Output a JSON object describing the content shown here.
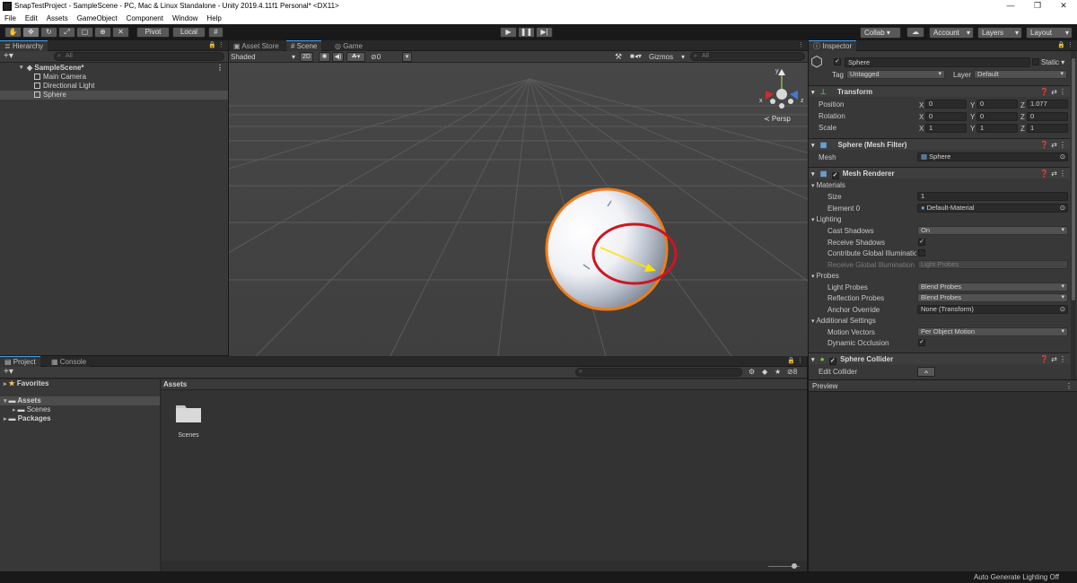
{
  "window": {
    "title": "SnapTestProject - SampleScene - PC, Mac & Linux Standalone - Unity 2019.4.11f1 Personal* <DX11>",
    "minimize": "—",
    "restore": "❐",
    "close": "✕"
  },
  "menu": [
    "File",
    "Edit",
    "Assets",
    "GameObject",
    "Component",
    "Window",
    "Help"
  ],
  "toolbar": {
    "pivot_label": "Pivot",
    "local_label": "Local",
    "collab_label": "Collab ▾",
    "account_label": "Account",
    "layers_label": "Layers",
    "layout_label": "Layout",
    "icons": [
      "hand-icon",
      "move-icon",
      "rotate-icon",
      "scale-icon",
      "rect-icon",
      "transform-icon",
      "custom-tool-icon"
    ]
  },
  "hierarchy": {
    "tab": "Hierarchy",
    "search_placeholder": "All",
    "scene_name": "SampleScene*",
    "items": [
      "Main Camera",
      "Directional Light",
      "Sphere"
    ],
    "selected": "Sphere"
  },
  "scene": {
    "tabs": [
      "Asset Store",
      "Scene",
      "Game"
    ],
    "active_tab": "Scene",
    "draw_mode": "Shaded",
    "mode_2d": "2D",
    "hidden_count": "0",
    "gizmos_label": "Gizmos",
    "search_placeholder": "All",
    "persp_label": "≺ Persp",
    "gizmo_axes": {
      "x": "x",
      "y": "y",
      "z": "z"
    }
  },
  "project": {
    "tabs": [
      "Project",
      "Console"
    ],
    "favorites": "Favorites",
    "assets_root": "Assets",
    "folders": [
      "Scenes"
    ],
    "packages": "Packages",
    "breadcrumb": "Assets",
    "asset_items": [
      {
        "name": "Scenes",
        "type": "folder"
      }
    ],
    "hidden_count": "8",
    "zoom_level": 0.82
  },
  "inspector": {
    "tab": "Inspector",
    "object_name": "Sphere",
    "static_label": "Static ▾",
    "tag_label": "Tag",
    "tag_value": "Untagged",
    "layer_label": "Layer",
    "layer_value": "Default",
    "transform": {
      "title": "Transform",
      "position_label": "Position",
      "rotation_label": "Rotation",
      "scale_label": "Scale",
      "position": {
        "x": "0",
        "y": "0",
        "z": "1.077"
      },
      "rotation": {
        "x": "0",
        "y": "0",
        "z": "0"
      },
      "scale": {
        "x": "1",
        "y": "1",
        "z": "1"
      }
    },
    "mesh_filter": {
      "title": "Sphere (Mesh Filter)",
      "mesh_label": "Mesh",
      "mesh_value": "Sphere"
    },
    "mesh_renderer": {
      "title": "Mesh Renderer",
      "materials_label": "Materials",
      "size_label": "Size",
      "size_value": "1",
      "element0_label": "Element 0",
      "element0_value": "Default-Material",
      "lighting_label": "Lighting",
      "cast_shadows_label": "Cast Shadows",
      "cast_shadows_value": "On",
      "receive_shadows_label": "Receive Shadows",
      "contribute_gi_label": "Contribute Global Illumination",
      "receive_gi_label": "Receive Global Illumination",
      "receive_gi_value": "Light Probes",
      "probes_label": "Probes",
      "light_probes_label": "Light Probes",
      "light_probes_value": "Blend Probes",
      "reflection_probes_label": "Reflection Probes",
      "reflection_probes_value": "Blend Probes",
      "anchor_override_label": "Anchor Override",
      "anchor_override_value": "None (Transform)",
      "additional_label": "Additional Settings",
      "motion_vectors_label": "Motion Vectors",
      "motion_vectors_value": "Per Object Motion",
      "dynamic_occlusion_label": "Dynamic Occlusion"
    },
    "sphere_collider": {
      "title": "Sphere Collider",
      "edit_collider_label": "Edit Collider"
    },
    "preview_label": "Preview"
  },
  "status": {
    "text": "Auto Generate Lighting Off"
  },
  "colors": {
    "selection_orange": "#f07c1a",
    "annotation_red": "#d2141e",
    "gizmo_yellow": "#ffe300",
    "tab_accent": "#4a9fe3"
  }
}
